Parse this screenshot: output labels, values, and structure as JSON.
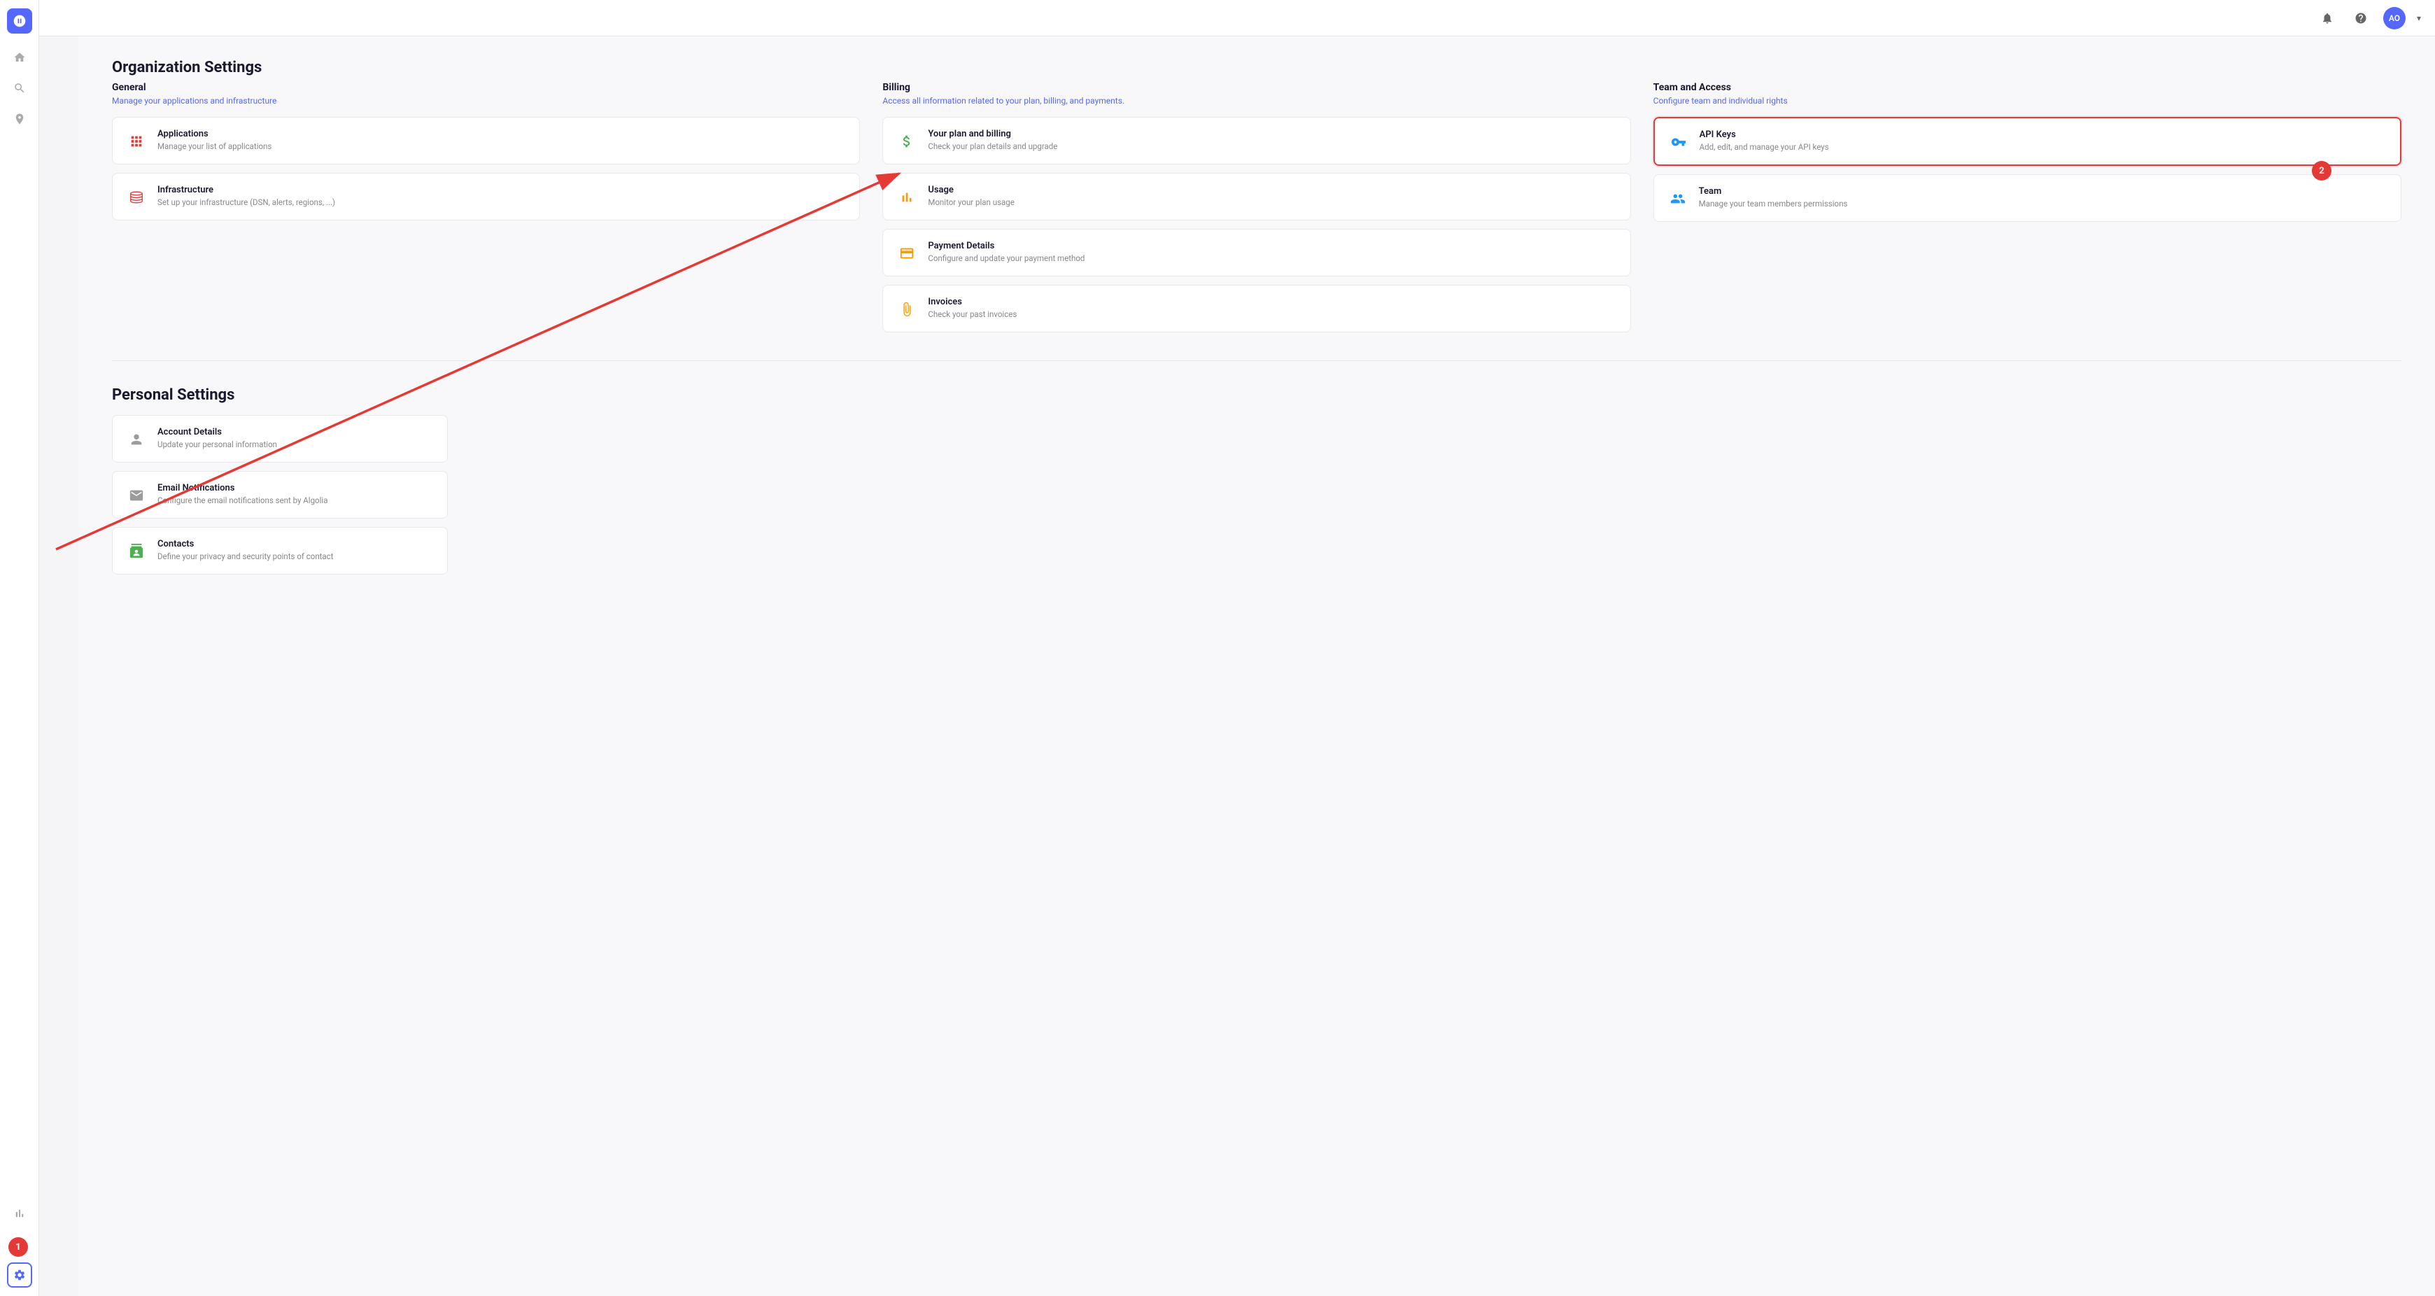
{
  "topbar": {
    "avatar_label": "AO",
    "chevron": "▾"
  },
  "sidebar": {
    "items": [
      {
        "id": "logo",
        "icon": "timer",
        "active": false
      },
      {
        "id": "home",
        "icon": "home",
        "active": false
      },
      {
        "id": "search1",
        "icon": "search",
        "active": false
      },
      {
        "id": "search2",
        "icon": "pin",
        "active": false
      },
      {
        "id": "charts",
        "icon": "bar-chart",
        "active": false
      },
      {
        "id": "database",
        "icon": "database",
        "active": false
      },
      {
        "id": "settings",
        "icon": "settings",
        "active": true
      }
    ]
  },
  "page": {
    "org_title": "Organization Settings",
    "personal_title": "Personal Settings",
    "sections": {
      "general": {
        "label": "General",
        "desc": "Manage your applications and infrastructure",
        "cards": [
          {
            "id": "applications",
            "title": "Applications",
            "desc": "Manage your list of applications",
            "icon": "grid"
          },
          {
            "id": "infrastructure",
            "title": "Infrastructure",
            "desc": "Set up your infrastructure (DSN, alerts, regions, ...)",
            "icon": "database"
          }
        ]
      },
      "billing": {
        "label": "Billing",
        "desc": "Access all information related to your plan, billing, and payments.",
        "cards": [
          {
            "id": "plan",
            "title": "Your plan and billing",
            "desc": "Check your plan details and upgrade",
            "icon": "dollar"
          },
          {
            "id": "usage",
            "title": "Usage",
            "desc": "Monitor your plan usage",
            "icon": "bar-chart"
          },
          {
            "id": "payment",
            "title": "Payment Details",
            "desc": "Configure and update your payment method",
            "icon": "credit-card"
          },
          {
            "id": "invoices",
            "title": "Invoices",
            "desc": "Check your past invoices",
            "icon": "paperclip"
          }
        ]
      },
      "team_access": {
        "label": "Team and Access",
        "desc": "Configure team and individual rights",
        "cards": [
          {
            "id": "api-keys",
            "title": "API Keys",
            "desc": "Add, edit, and manage your API keys",
            "icon": "key",
            "highlighted": true
          },
          {
            "id": "team",
            "title": "Team",
            "desc": "Manage your team members permissions",
            "icon": "users"
          }
        ]
      }
    },
    "personal": {
      "cards": [
        {
          "id": "account-details",
          "title": "Account Details",
          "desc": "Update your personal information",
          "icon": "user"
        },
        {
          "id": "email-notifications",
          "title": "Email Notifications",
          "desc": "Configure the email notifications sent by Algolia",
          "icon": "email"
        },
        {
          "id": "contacts",
          "title": "Contacts",
          "desc": "Define your privacy and security points of contact",
          "icon": "contact"
        }
      ]
    }
  },
  "steps": {
    "step1_label": "1",
    "step2_label": "2"
  }
}
